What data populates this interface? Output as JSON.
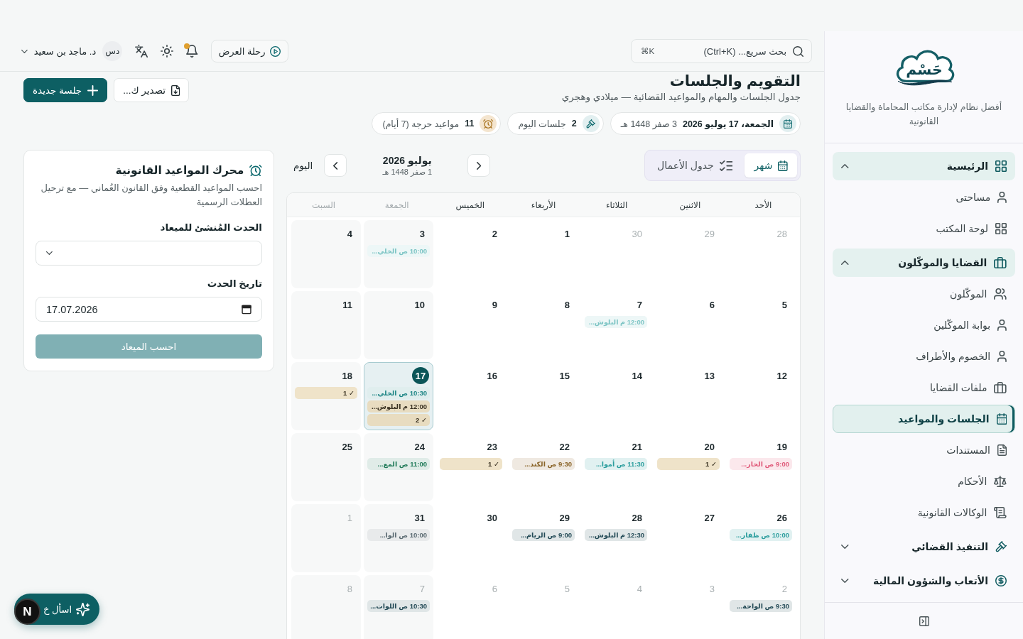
{
  "sidebar": {
    "brand": "حَسْم",
    "tagline": "أفضل نظام لإدارة مكاتب المحاماة والقضايا القانونية",
    "nav": [
      {
        "label": "الرئيسية",
        "expanded": true,
        "children": [
          {
            "label": "مساحتى",
            "selected": false
          },
          {
            "label": "لوحة المكتب",
            "selected": false
          }
        ]
      },
      {
        "label": "القضايا والموكّلون",
        "expanded": true,
        "children": [
          {
            "label": "الموكّلون",
            "selected": false
          },
          {
            "label": "بوابة الموكّلين",
            "selected": false
          },
          {
            "label": "الخصوم والأطراف",
            "selected": false
          },
          {
            "label": "ملفات القضايا",
            "selected": false
          },
          {
            "label": "الجلسات والمواعيد",
            "selected": true
          },
          {
            "label": "المستندات",
            "selected": false
          },
          {
            "label": "الأحكام",
            "selected": false
          },
          {
            "label": "الوكالات القانونية",
            "selected": false
          }
        ]
      },
      {
        "label": "التنفيذ القضائي",
        "expanded": false
      },
      {
        "label": "الأتعاب والشؤون المالية",
        "expanded": false
      }
    ]
  },
  "topbar": {
    "search": {
      "placeholder": "بحث سريع... (Ctrl+K)",
      "shortcut": "⌘K"
    },
    "tour_button": "رحلة العرض",
    "notifications": {
      "unread": true
    },
    "user": {
      "initials": "دس",
      "name": "د. ماجد بن سعيد"
    }
  },
  "page": {
    "title": "التقويم والجلسات",
    "subtitle": "جدول الجلسات والمهام والمواعيد القضائية — ميلادي وهجري",
    "stats": [
      {
        "kind": "date",
        "value": "الجمعة، 17 يوليو 2026",
        "detail": "3 صفر 1448 هـ"
      },
      {
        "kind": "sessions",
        "value": "2",
        "detail": "جلسات اليوم"
      },
      {
        "kind": "deadlines",
        "value": "11",
        "detail": "مواعيد حرجة (7 أيام)"
      }
    ],
    "actions": [
      {
        "kind": "export",
        "label": "تصدير ك..."
      },
      {
        "kind": "create",
        "label": "جلسة جديدة"
      }
    ]
  },
  "calendar": {
    "views": [
      {
        "label": "شهر",
        "selected": true
      },
      {
        "label": "جدول الأعمال",
        "selected": false
      }
    ],
    "month": "يوليو 2026",
    "hijri": "1 صفر 1448 هـ",
    "today_button": "اليوم",
    "weekdays": [
      {
        "label": "الأحد",
        "weekend": false
      },
      {
        "label": "الاثنين",
        "weekend": false
      },
      {
        "label": "الثلاثاء",
        "weekend": false
      },
      {
        "label": "الأربعاء",
        "weekend": false
      },
      {
        "label": "الخميس",
        "weekend": false
      },
      {
        "label": "الجمعة",
        "weekend": true
      },
      {
        "label": "السبت",
        "weekend": true
      }
    ],
    "weeks": [
      [
        {
          "day": "28",
          "outside": true,
          "selected": false
        },
        {
          "day": "29",
          "outside": true,
          "selected": false
        },
        {
          "day": "30",
          "outside": true,
          "selected": false
        },
        {
          "day": "1",
          "outside": false,
          "selected": false
        },
        {
          "day": "2",
          "outside": false,
          "selected": false
        },
        {
          "day": "3",
          "outside": false,
          "selected": false,
          "events": [
            {
              "kind": "tint",
              "text": "10:00 ص الخلي...",
              "color": "#7cc4c4"
            }
          ]
        },
        {
          "day": "4",
          "outside": false,
          "selected": false
        }
      ],
      [
        {
          "day": "5",
          "outside": false,
          "selected": false
        },
        {
          "day": "6",
          "outside": false,
          "selected": false
        },
        {
          "day": "7",
          "outside": false,
          "selected": false,
          "events": [
            {
              "kind": "tint",
              "text": "12:00 م البلوش...",
              "color": "#7cc4c4"
            }
          ]
        },
        {
          "day": "8",
          "outside": false,
          "selected": false
        },
        {
          "day": "9",
          "outside": false,
          "selected": false
        },
        {
          "day": "10",
          "outside": false,
          "selected": false
        },
        {
          "day": "11",
          "outside": false,
          "selected": false
        }
      ],
      [
        {
          "day": "12",
          "outside": false,
          "selected": false
        },
        {
          "day": "13",
          "outside": false,
          "selected": false
        },
        {
          "day": "14",
          "outside": false,
          "selected": false
        },
        {
          "day": "15",
          "outside": false,
          "selected": false
        },
        {
          "day": "16",
          "outside": false,
          "selected": false
        },
        {
          "day": "17",
          "outside": false,
          "selected": true,
          "events": [
            {
              "kind": "tint",
              "text": "10:30 ص الخلي...",
              "color": "#1f8686"
            },
            {
              "kind": "fill",
              "text": "12:00 م البلوش...",
              "color": "#e8dcc0"
            },
            {
              "kind": "fill",
              "text": "✓ 2",
              "color": "#e8dcc0"
            }
          ]
        },
        {
          "day": "18",
          "outside": false,
          "selected": false,
          "events": [
            {
              "kind": "fill",
              "text": "✓ 1",
              "color": "#efe3c9"
            }
          ]
        }
      ],
      [
        {
          "day": "19",
          "outside": false,
          "selected": false,
          "events": [
            {
              "kind": "tint",
              "text": "9:00 ص الحار...",
              "color": "#e05a7a"
            }
          ]
        },
        {
          "day": "20",
          "outside": false,
          "selected": false,
          "events": [
            {
              "kind": "fill",
              "text": "✓ 1",
              "color": "#efe3c9"
            }
          ]
        },
        {
          "day": "21",
          "outside": false,
          "selected": false,
          "events": [
            {
              "kind": "tint",
              "text": "11:30 ص أموا...",
              "color": "#2a9d9d"
            }
          ]
        },
        {
          "day": "22",
          "outside": false,
          "selected": false,
          "events": [
            {
              "kind": "tint",
              "text": "9:30 ص الكند...",
              "color": "#8a6428"
            }
          ]
        },
        {
          "day": "23",
          "outside": false,
          "selected": false,
          "events": [
            {
              "kind": "fill",
              "text": "✓ 1",
              "color": "#efe3c9"
            }
          ]
        },
        {
          "day": "24",
          "outside": false,
          "selected": false,
          "events": [
            {
              "kind": "tint",
              "text": "11:00 ص المع...",
              "color": "#1f7a58"
            }
          ]
        },
        {
          "day": "25",
          "outside": false,
          "selected": false
        }
      ],
      [
        {
          "day": "26",
          "outside": false,
          "selected": false,
          "events": [
            {
              "kind": "tint",
              "text": "10:00 ص ظفار...",
              "color": "#2a9d9d"
            }
          ]
        },
        {
          "day": "27",
          "outside": false,
          "selected": false
        },
        {
          "day": "28",
          "outside": false,
          "selected": false,
          "events": [
            {
              "kind": "tint",
              "text": "12:30 م البلوش...",
              "color": "#234a56"
            }
          ]
        },
        {
          "day": "29",
          "outside": false,
          "selected": false,
          "events": [
            {
              "kind": "tint",
              "text": "9:00 ص الريام...",
              "color": "#234a56"
            }
          ]
        },
        {
          "day": "30",
          "outside": false,
          "selected": false
        },
        {
          "day": "31",
          "outside": false,
          "selected": false,
          "events": [
            {
              "kind": "tint",
              "text": "10:00 ص الوا...",
              "color": "#5b6b72"
            }
          ]
        },
        {
          "day": "1",
          "outside": true,
          "selected": false
        }
      ],
      [
        {
          "day": "2",
          "outside": true,
          "selected": false,
          "events": [
            {
              "kind": "tint",
              "text": "9:30 ص الواحة...",
              "color": "#234a56"
            }
          ]
        },
        {
          "day": "3",
          "outside": true,
          "selected": false
        },
        {
          "day": "4",
          "outside": true,
          "selected": false
        },
        {
          "day": "5",
          "outside": true,
          "selected": false
        },
        {
          "day": "6",
          "outside": true,
          "selected": false
        },
        {
          "day": "7",
          "outside": true,
          "selected": false,
          "events": [
            {
              "kind": "tint",
              "text": "10:30 ص اللوات...",
              "color": "#234a56"
            }
          ]
        },
        {
          "day": "8",
          "outside": true,
          "selected": false
        }
      ]
    ]
  },
  "deadline_engine": {
    "title": "محرك المواعيد القانونية",
    "description": "احسب المواعيد القطعية وفق القانون العُماني — مع ترحيل العطلات الرسمية",
    "trigger_label": "الحدث المُنشئ للميعاد",
    "date_label": "تاريخ الحدث",
    "date_value": "17.07.2026",
    "submit": {
      "label": "احسب الميعاد",
      "disabled": true
    }
  },
  "assistant_button": {
    "label": "اسأل خ"
  },
  "dev_badge": {
    "label": "N"
  }
}
